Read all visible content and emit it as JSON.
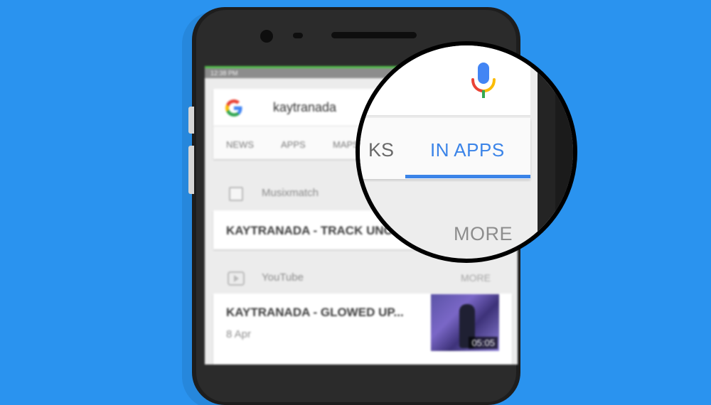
{
  "status_bar": {
    "time": "12:38 PM"
  },
  "search": {
    "query": "kaytranada"
  },
  "tabs": [
    {
      "label": "NEWS"
    },
    {
      "label": "APPS"
    },
    {
      "label": "MAPS"
    }
  ],
  "sections": [
    {
      "source": "Musixmatch",
      "result_title": "KAYTRANADA - TRACK UNO"
    },
    {
      "source": "YouTube",
      "more_label": "MORE",
      "result_title": "KAYTRANADA - GLOWED UP...",
      "result_date": "8 Apr",
      "duration": "05:05"
    }
  ],
  "magnifier": {
    "tab_partial": "KS",
    "tab_active": "IN APPS",
    "more_label": "MORE"
  },
  "colors": {
    "background": "#2a93ef",
    "active_tab": "#3b84e8"
  },
  "icons": {
    "google": "google-logo-icon",
    "mic": "microphone-icon",
    "checkbox": "checkbox-icon",
    "youtube": "youtube-icon"
  }
}
